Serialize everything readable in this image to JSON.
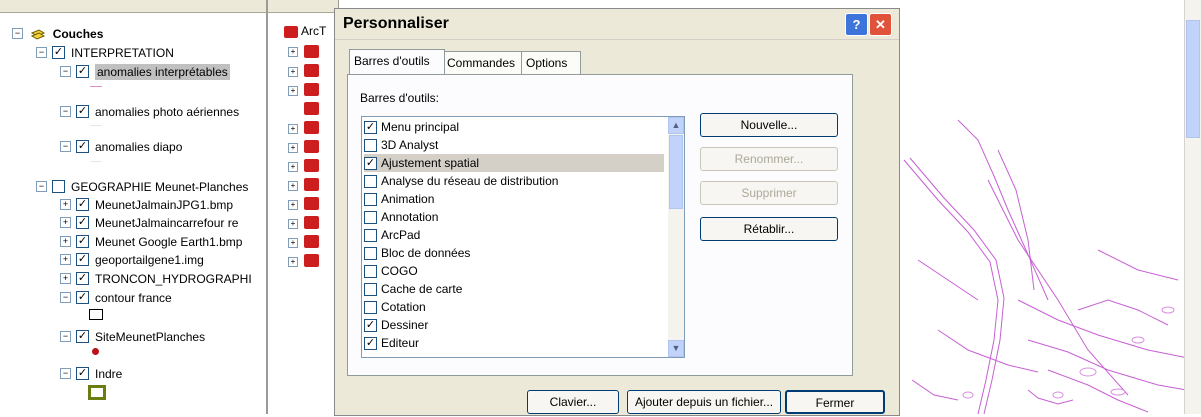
{
  "toc": {
    "root_label": "Couches",
    "items": [
      {
        "label": "INTERPRETATION",
        "checked": true,
        "expander": "−"
      },
      {
        "label": "anomalies interprétables",
        "checked": true,
        "expander": "−"
      },
      {
        "label": "anomalies photo aériennes",
        "checked": true,
        "expander": "−"
      },
      {
        "label": "anomalies diapo",
        "checked": true,
        "expander": "−"
      },
      {
        "label": "GEOGRAPHIE Meunet-Planches",
        "checked": false,
        "expander": "−"
      },
      {
        "label": "MeunetJalmainJPG1.bmp",
        "checked": true,
        "expander": "+"
      },
      {
        "label": "MeunetJalmaincarrefour re",
        "checked": true,
        "expander": "+"
      },
      {
        "label": "Meunet Google Earth1.bmp",
        "checked": true,
        "expander": "+"
      },
      {
        "label": "geoportailgene1.img",
        "checked": true,
        "expander": "+"
      },
      {
        "label": "TRONCON_HYDROGRAPHI",
        "checked": true,
        "expander": "+"
      },
      {
        "label": "contour france",
        "checked": true,
        "expander": "−"
      },
      {
        "label": "SiteMeunetPlanches",
        "checked": true,
        "expander": "−"
      },
      {
        "label": "Indre",
        "checked": true,
        "expander": "−"
      }
    ]
  },
  "catalog": {
    "root_label": "ArcT"
  },
  "dialog": {
    "title": "Personnaliser",
    "help_label": "?",
    "close_label": "✕",
    "tabs": [
      "Barres d'outils",
      "Commandes",
      "Options"
    ],
    "section_label": "Barres d'outils:",
    "toolbars": [
      {
        "label": "Menu principal",
        "checked": true
      },
      {
        "label": "3D Analyst",
        "checked": false
      },
      {
        "label": "Ajustement spatial",
        "checked": true
      },
      {
        "label": "Analyse du réseau de distribution",
        "checked": false
      },
      {
        "label": "Animation",
        "checked": false
      },
      {
        "label": "Annotation",
        "checked": false
      },
      {
        "label": "ArcPad",
        "checked": false
      },
      {
        "label": "Bloc de données",
        "checked": false
      },
      {
        "label": "COGO",
        "checked": false
      },
      {
        "label": "Cache de carte",
        "checked": false
      },
      {
        "label": "Cotation",
        "checked": false
      },
      {
        "label": "Dessiner",
        "checked": true
      },
      {
        "label": "Editeur",
        "checked": true
      }
    ],
    "buttons": {
      "new": "Nouvelle...",
      "rename": "Renommer...",
      "delete": "Supprimer",
      "reset": "Rétablir...",
      "keyboard": "Clavier...",
      "add_from_file": "Ajouter depuis un fichier...",
      "close": "Fermer"
    }
  },
  "colors": {
    "accent_close": "#e0533a",
    "help_blue": "#3d74d9",
    "selection": "#d4d0c8",
    "map_lines": "#c760d4"
  }
}
